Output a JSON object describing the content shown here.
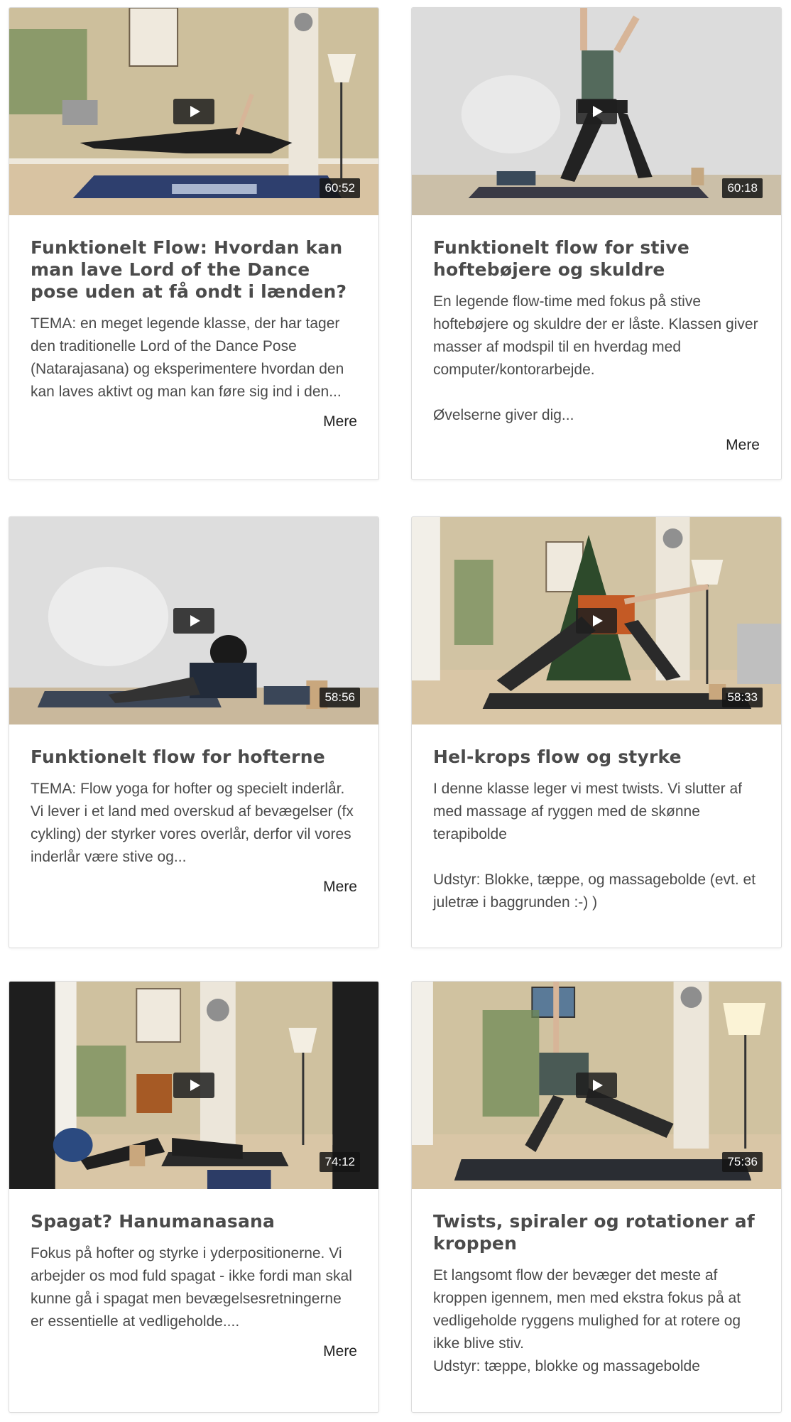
{
  "videos": [
    {
      "title": "Funktionelt Flow: Hvordan kan man lave Lord of the Dance pose uden at få ondt i lænden?",
      "description": "TEMA: en meget legende klasse, der har tager den traditionelle Lord of the Dance Pose (Natarajasana) og eksperimentere hvordan den kan laves aktivt og man kan føre sig ind i den...",
      "duration": "60:52",
      "more_label": "Mere"
    },
    {
      "title": "Funktionelt flow for stive hoftebøjere og skuldre",
      "description": "En legende flow-time med fokus på stive hoftebøjere og skuldre der er låste. Klassen giver masser af modspil til en hverdag med computer/kontorarbejde.\n\nØvelserne giver dig...",
      "duration": "60:18",
      "more_label": "Mere"
    },
    {
      "title": "Funktionelt flow for hofterne",
      "description": "TEMA: Flow yoga for hofter og specielt inderlår. Vi lever i et land med overskud af bevægelser (fx cykling) der styrker vores overlår, derfor vil vores inderlår være stive og...",
      "duration": "58:56",
      "more_label": "Mere"
    },
    {
      "title": "Hel-krops flow og styrke",
      "description": "I denne klasse leger vi mest twists. Vi slutter af med massage af ryggen med de skønne terapibolde\n\nUdstyr: Blokke, tæppe, og massagebolde (evt. et juletræ i baggrunden :-) )",
      "duration": "58:33"
    },
    {
      "title": "Spagat? Hanumanasana",
      "description": "Fokus på hofter og styrke i yderpositionerne. Vi arbejder os mod fuld spagat - ikke fordi man skal kunne gå i spagat men bevægelsesretningerne er essentielle at vedligeholde....",
      "duration": "74:12",
      "more_label": "Mere"
    },
    {
      "title": "Twists, spiraler og rotationer af kroppen",
      "description": "Et langsomt flow der bevæger det meste af kroppen igennem, men med ekstra fokus på at vedligeholde ryggens mulighed for at rotere og ikke blive stiv.\nUdstyr: tæppe, blokke og massagebolde",
      "duration": "75:36"
    }
  ],
  "colors": {
    "title": "#4b4b4b",
    "text": "#4a4a4a",
    "border": "#dcdcdc",
    "mat": "#2e3f6e"
  }
}
